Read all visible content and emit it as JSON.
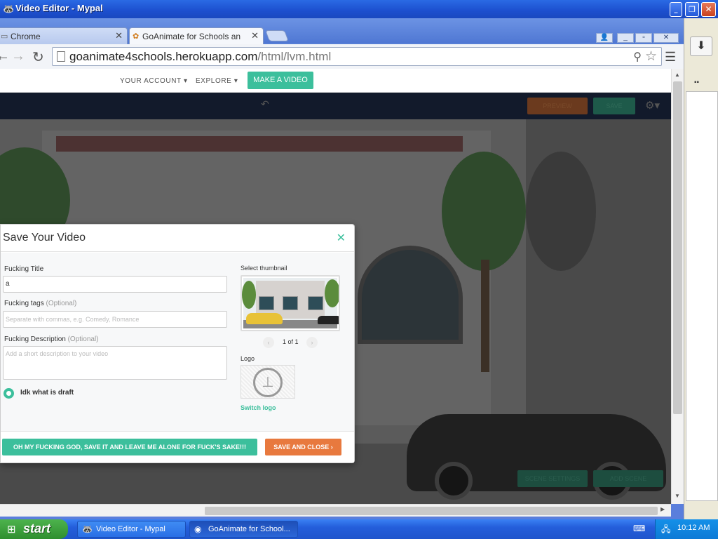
{
  "window": {
    "title": "Video Editor - Mypal",
    "controls": [
      "_",
      "▫",
      "✕"
    ],
    "inner_controls": [
      "👤",
      "_",
      "▫",
      "✕"
    ]
  },
  "browser": {
    "tabs": [
      {
        "label": "Chrome",
        "active": false
      },
      {
        "label": "GoAnimate for Schools an",
        "active": true
      }
    ],
    "url_host": "goanimate4schools.herokuapp.com",
    "url_path": "/html/lvm.html"
  },
  "site_nav": {
    "your_account": "YOUR ACCOUNT",
    "explore": "EXPLORE",
    "make_video": "MAKE A VIDEO"
  },
  "editor": {
    "preview_label": "PREVIEW",
    "save_label": "SAVE",
    "scene_settings": "SCENE SETTINGS",
    "add_scene": "ADD SCENE"
  },
  "modal": {
    "title": "Save Your Video",
    "title_field_label": "Fucking Title",
    "title_field_value": "a",
    "tags_label": "Fucking tags",
    "tags_optional": "(Optional)",
    "tags_placeholder": "Separate with commas, e.g. Comedy, Romance",
    "description_label": "Fucking Description",
    "description_optional": "(Optional)",
    "description_placeholder": "Add a short description to your video",
    "draft_label": "Idk what is draft",
    "thumbnail_label": "Select thumbnail",
    "thumbnail_pager": "1 of 1",
    "logo_label": "Logo",
    "switch_logo": "Switch logo",
    "primary_button": "OH MY FUCKING GOD, SAVE IT AND LEAVE ME ALONE FOR FUCK'S SAKE!!!",
    "secondary_button": "SAVE AND CLOSE ›"
  },
  "taskbar": {
    "start": "start",
    "items": [
      {
        "label": "Video Editor - Mypal",
        "pressed": false
      },
      {
        "label": "GoAnimate for School...",
        "pressed": true
      }
    ],
    "clock": "10:12 AM"
  },
  "colors": {
    "accent_green": "#3cbf9c",
    "accent_orange": "#e8793e",
    "xp_blue": "#245edb"
  }
}
